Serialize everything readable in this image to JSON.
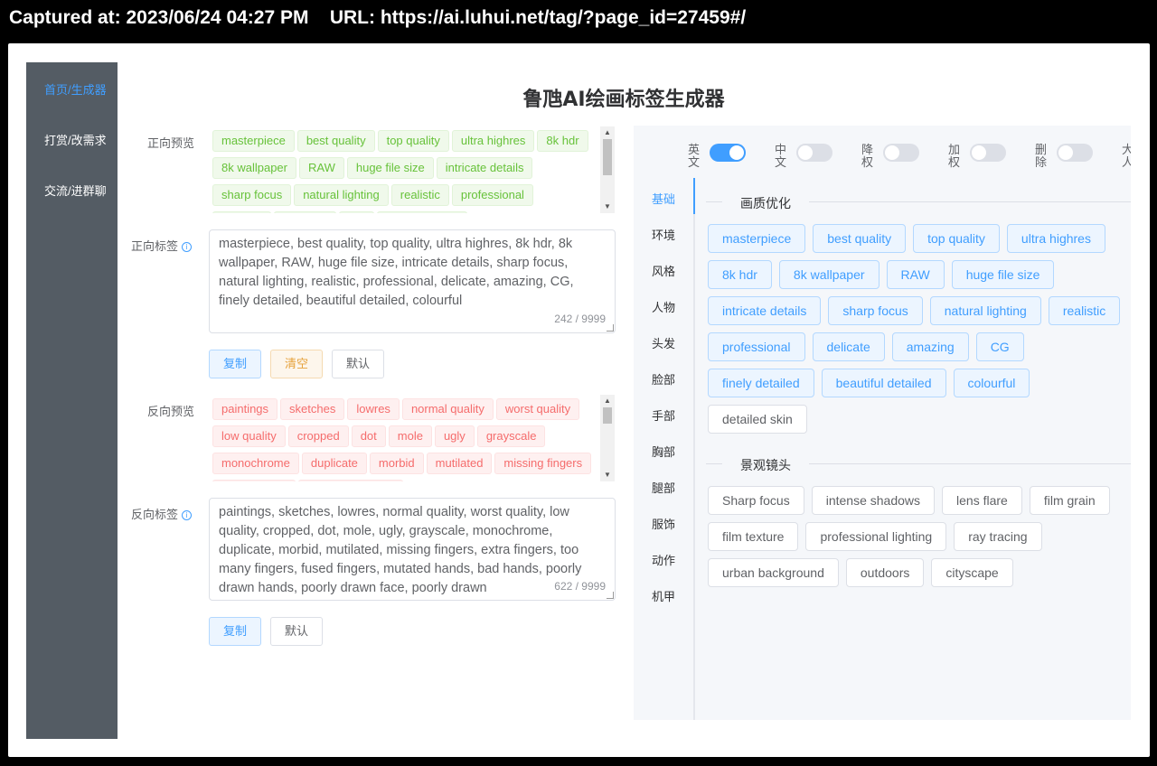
{
  "capture": {
    "text": "Captured at: 2023/06/24 04:27 PM    URL: https://ai.luhui.net/tag/?page_id=27459#/"
  },
  "sidebar": {
    "items": [
      {
        "label": "首页/生成器",
        "active": true
      },
      {
        "label": "打赏/改需求",
        "active": false
      },
      {
        "label": "交流/进群聊",
        "active": false
      }
    ]
  },
  "page_title": "鲁虺AI绘画标签生成器",
  "positive": {
    "preview_label": "正向预览",
    "preview_tags": [
      "masterpiece",
      "best quality",
      "top quality",
      "ultra highres",
      "8k hdr",
      "8k wallpaper",
      "RAW",
      "huge file size",
      "intricate details",
      "sharp focus",
      "natural lighting",
      "realistic",
      "professional",
      "delicate",
      "amazing",
      "CG",
      "finely detailed"
    ],
    "tags_label": "正向标签",
    "text": "masterpiece, best quality, top quality, ultra highres, 8k hdr, 8k wallpaper, RAW, huge file size, intricate details, sharp focus, natural lighting, realistic, professional, delicate, amazing, CG, finely detailed, beautiful detailed, colourful",
    "count": "242 / 9999",
    "copy_label": "复制",
    "clear_label": "清空",
    "default_label": "默认"
  },
  "negative": {
    "preview_label": "反向预览",
    "preview_tags": [
      "paintings",
      "sketches",
      "lowres",
      "normal quality",
      "worst quality",
      "low quality",
      "cropped",
      "dot",
      "mole",
      "ugly",
      "grayscale",
      "monochrome",
      "duplicate",
      "morbid",
      "mutilated",
      "missing fingers",
      "extra fingers",
      "too many fingers"
    ],
    "tags_label": "反向标签",
    "text": "paintings, sketches, lowres, normal quality, worst quality, low quality, cropped, dot, mole, ugly, grayscale, monochrome, duplicate, morbid, mutilated, missing fingers, extra fingers, too many fingers, fused fingers, mutated hands, bad hands, poorly drawn hands, poorly drawn face, poorly drawn",
    "count": "622 / 9999",
    "copy_label": "复制",
    "default_label": "默认"
  },
  "switches": [
    {
      "label": "英文",
      "on": true
    },
    {
      "label": "中文",
      "on": false
    },
    {
      "label": "降权",
      "on": false
    },
    {
      "label": "加权",
      "on": false
    },
    {
      "label": "删除",
      "on": false
    },
    {
      "label": "大人",
      "on": false
    }
  ],
  "tabs": [
    "基础",
    "环境",
    "风格",
    "人物",
    "头发",
    "脸部",
    "手部",
    "胸部",
    "腿部",
    "服饰",
    "动作",
    "机甲"
  ],
  "sections": [
    {
      "title": "画质优化",
      "tags": [
        {
          "label": "masterpiece",
          "selected": true
        },
        {
          "label": "best quality",
          "selected": true
        },
        {
          "label": "top quality",
          "selected": true
        },
        {
          "label": "ultra highres",
          "selected": true
        },
        {
          "label": "8k hdr",
          "selected": true
        },
        {
          "label": "8k wallpaper",
          "selected": true
        },
        {
          "label": "RAW",
          "selected": true
        },
        {
          "label": "huge file size",
          "selected": true
        },
        {
          "label": "intricate details",
          "selected": true
        },
        {
          "label": "sharp focus",
          "selected": true
        },
        {
          "label": "natural lighting",
          "selected": true
        },
        {
          "label": "realistic",
          "selected": true
        },
        {
          "label": "professional",
          "selected": true
        },
        {
          "label": "delicate",
          "selected": true
        },
        {
          "label": "amazing",
          "selected": true
        },
        {
          "label": "CG",
          "selected": true
        },
        {
          "label": "finely detailed",
          "selected": true
        },
        {
          "label": "beautiful detailed",
          "selected": true
        },
        {
          "label": "colourful",
          "selected": true
        },
        {
          "label": "detailed skin",
          "selected": false
        }
      ]
    },
    {
      "title": "景观镜头",
      "tags": [
        {
          "label": "Sharp focus",
          "selected": false
        },
        {
          "label": "intense shadows",
          "selected": false
        },
        {
          "label": "lens flare",
          "selected": false
        },
        {
          "label": "film grain",
          "selected": false
        },
        {
          "label": "film texture",
          "selected": false
        },
        {
          "label": "professional lighting",
          "selected": false
        },
        {
          "label": "ray tracing",
          "selected": false
        },
        {
          "label": "urban background",
          "selected": false
        },
        {
          "label": "outdoors",
          "selected": false
        },
        {
          "label": "cityscape",
          "selected": false
        }
      ]
    }
  ],
  "colors": {
    "accent": "#409eff",
    "sidebar_bg": "#545c64",
    "tag_green": "#67c23a",
    "tag_red": "#f56c6c"
  }
}
